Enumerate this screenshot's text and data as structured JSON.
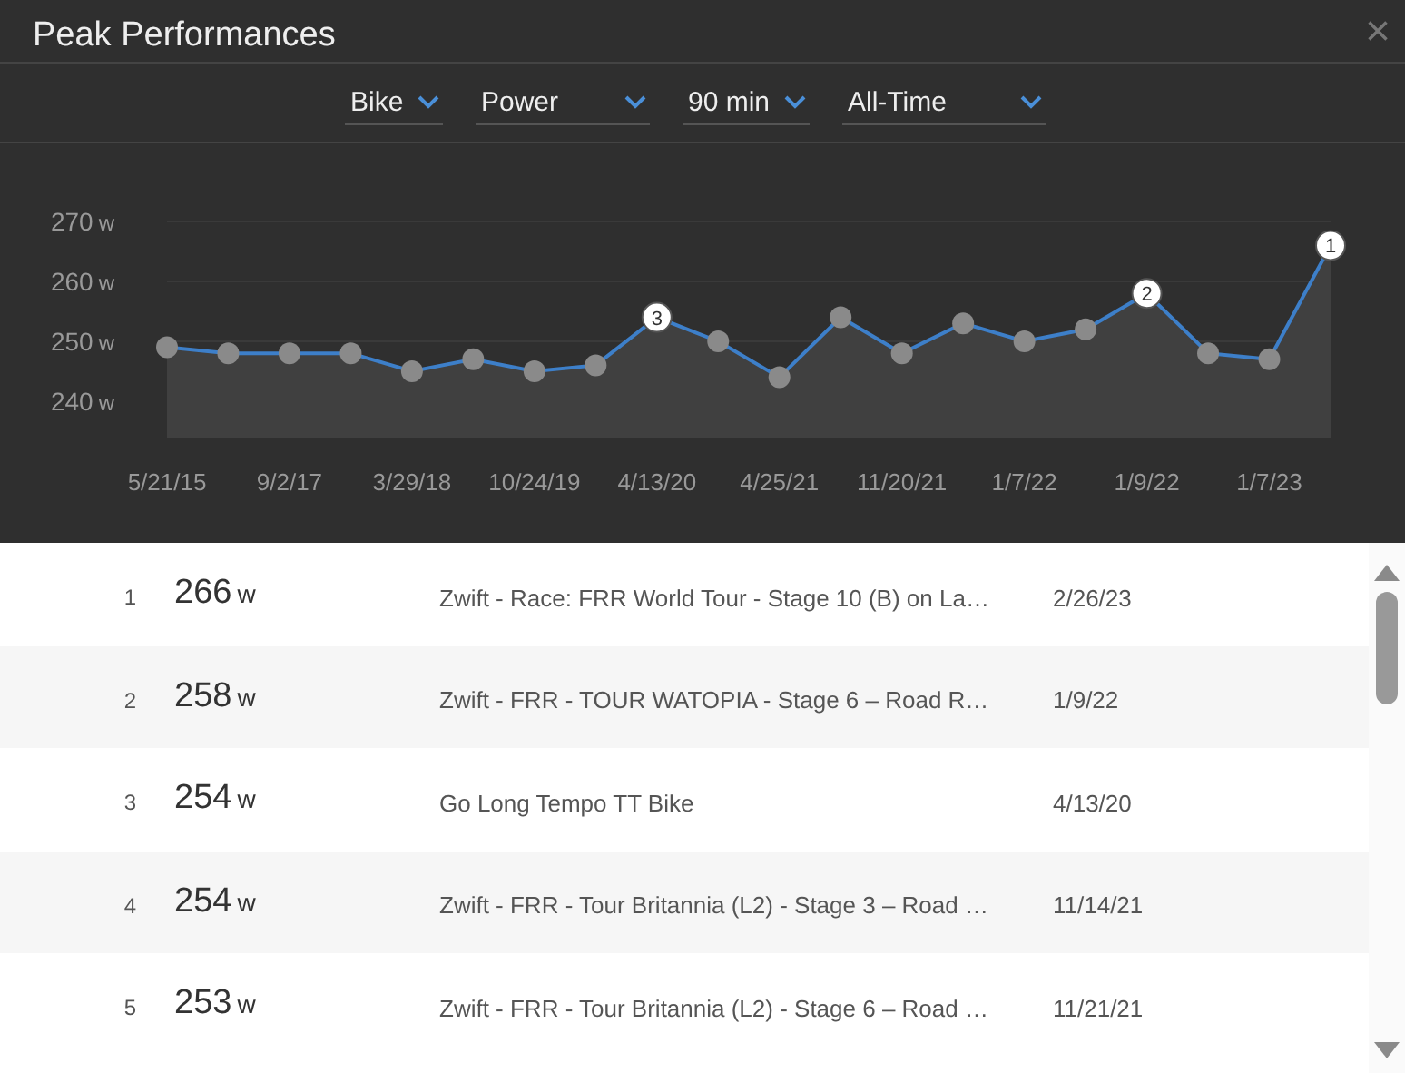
{
  "dialog": {
    "title": "Peak Performances",
    "close": "×"
  },
  "filters": [
    {
      "value": "Bike"
    },
    {
      "value": "Power"
    },
    {
      "value": "90 min"
    },
    {
      "value": "All-Time"
    }
  ],
  "chart": {
    "chart_data": {
      "type": "area",
      "categories": [
        "5/21/15",
        null,
        "9/2/17",
        null,
        "3/29/18",
        null,
        "10/24/19",
        null,
        "4/13/20",
        null,
        "4/25/21",
        null,
        "11/20/21",
        null,
        "1/7/22",
        null,
        "1/9/22",
        null,
        "1/7/23",
        null
      ],
      "series": [
        {
          "color": "#3d7fc9",
          "values": [
            249,
            248,
            248,
            248,
            245,
            247,
            245,
            246,
            254,
            250,
            244,
            254,
            248,
            253,
            250,
            252,
            258,
            248,
            247,
            266
          ]
        }
      ],
      "grid": true,
      "ylim": [
        240,
        270
      ],
      "yticks": [
        {
          "value": 240,
          "label": "240 w"
        },
        {
          "value": 250,
          "label": "250 w"
        },
        {
          "value": 260,
          "label": "260 w"
        },
        {
          "value": 270,
          "label": "270 w"
        }
      ],
      "annotations": [
        {
          "y": 266,
          "text": "1"
        },
        {
          "y": 258,
          "text": "2"
        },
        {
          "y": 254,
          "text": "3"
        }
      ]
    }
  },
  "rows": [
    {
      "rank": "1",
      "value": "266",
      "unit": "w",
      "name": "Zwift - Race: FRR World Tour - Stage 10 (B) on La…",
      "date": "2/26/23"
    },
    {
      "rank": "2",
      "value": "258",
      "unit": "w",
      "name": "Zwift - FRR - TOUR WATOPIA - Stage 6 – Road R…",
      "date": "1/9/22"
    },
    {
      "rank": "3",
      "value": "254",
      "unit": "w",
      "name": "Go Long Tempo TT Bike",
      "date": "4/13/20"
    },
    {
      "rank": "4",
      "value": "254",
      "unit": "w",
      "name": "Zwift - FRR - Tour Britannia (L2) - Stage 3 – Road …",
      "date": "11/14/21"
    },
    {
      "rank": "5",
      "value": "253",
      "unit": "w",
      "name": "Zwift - FRR - Tour Britannia (L2) - Stage 6 – Road …",
      "date": "11/21/21"
    }
  ]
}
